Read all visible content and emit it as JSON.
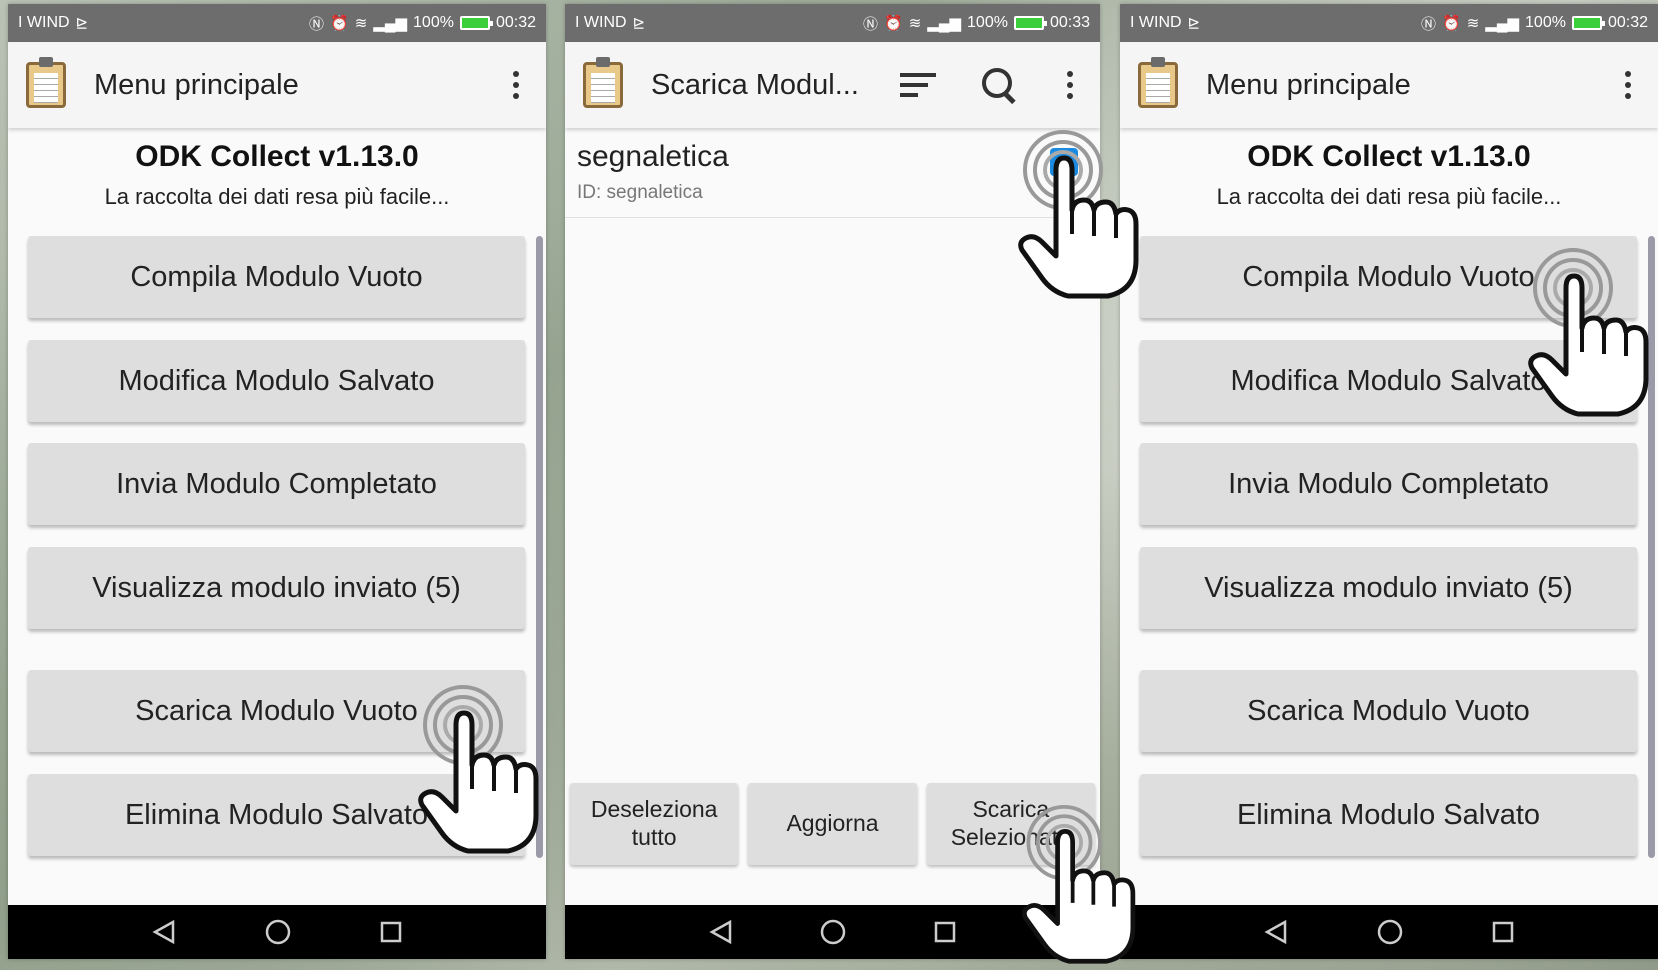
{
  "colors": {
    "status_bar": "#6d6d6d",
    "app_bar": "#f5f5f5",
    "button": "#dedede",
    "checkbox_accent": "#1a8be0",
    "battery": "#3ccf3c",
    "nav_bar": "#000000"
  },
  "status": {
    "carrier": "I WIND",
    "battery_pct": "100%",
    "time_1": "00:32",
    "time_2": "00:33",
    "time_3": "00:32"
  },
  "screen1": {
    "app_title": "Menu principale",
    "version": "ODK Collect v1.13.0",
    "tagline": "La raccolta dei dati resa più facile...",
    "buttons": [
      "Compila Modulo Vuoto",
      "Modifica Modulo Salvato",
      "Invia Modulo Completato",
      "Visualizza modulo inviato (5)",
      "Scarica Modulo Vuoto",
      "Elimina Modulo Salvato"
    ]
  },
  "screen2": {
    "app_title": "Scarica Modul...",
    "form_name": "segnaletica",
    "form_id": "ID: segnaletica",
    "bottom_buttons": [
      "Deseleziona tutto",
      "Aggiorna",
      "Scarica Selezionato"
    ]
  },
  "screen3": {
    "app_title": "Menu principale",
    "version": "ODK Collect v1.13.0",
    "tagline": "La raccolta dei dati resa più facile...",
    "buttons": [
      "Compila Modulo Vuoto",
      "Modifica Modulo Salvato",
      "Invia Modulo Completato",
      "Visualizza modulo inviato (5)",
      "Scarica Modulo Vuoto",
      "Elimina Modulo Salvato"
    ]
  },
  "icons": [
    "clipboard-icon",
    "overflow-menu-icon",
    "sort-icon",
    "search-icon",
    "nfc-icon",
    "alarm-icon",
    "wifi-icon",
    "signal-icon",
    "battery-icon",
    "back-icon",
    "home-icon",
    "recents-icon",
    "tap-hand-icon"
  ]
}
